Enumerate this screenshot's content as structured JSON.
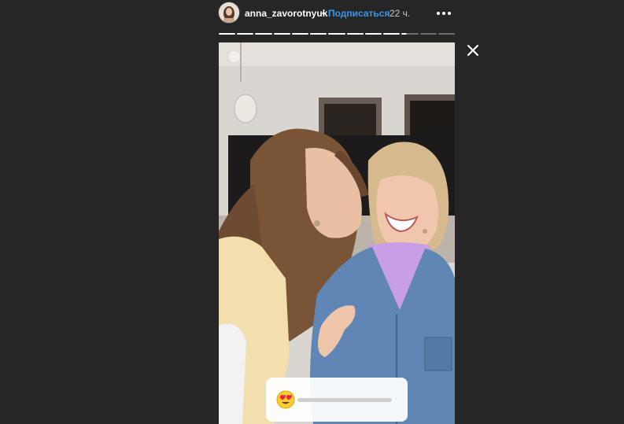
{
  "header": {
    "username": "anna_zavorotnyuk",
    "separator": "•",
    "follow_label": "Подписаться",
    "time": "22 ч.",
    "more_icon": "more-horizontal-icon"
  },
  "progress": {
    "total_segments": 13,
    "viewed_segments": 10,
    "current_segment": 11,
    "viewed_color": "#ffffff",
    "remaining_color": "#6e6e6e"
  },
  "story": {
    "media": "photo-two-women-kiss",
    "slider_sticker": {
      "emoji": "heart-eyes-emoji",
      "value": 0
    }
  },
  "close_icon": "close-icon"
}
